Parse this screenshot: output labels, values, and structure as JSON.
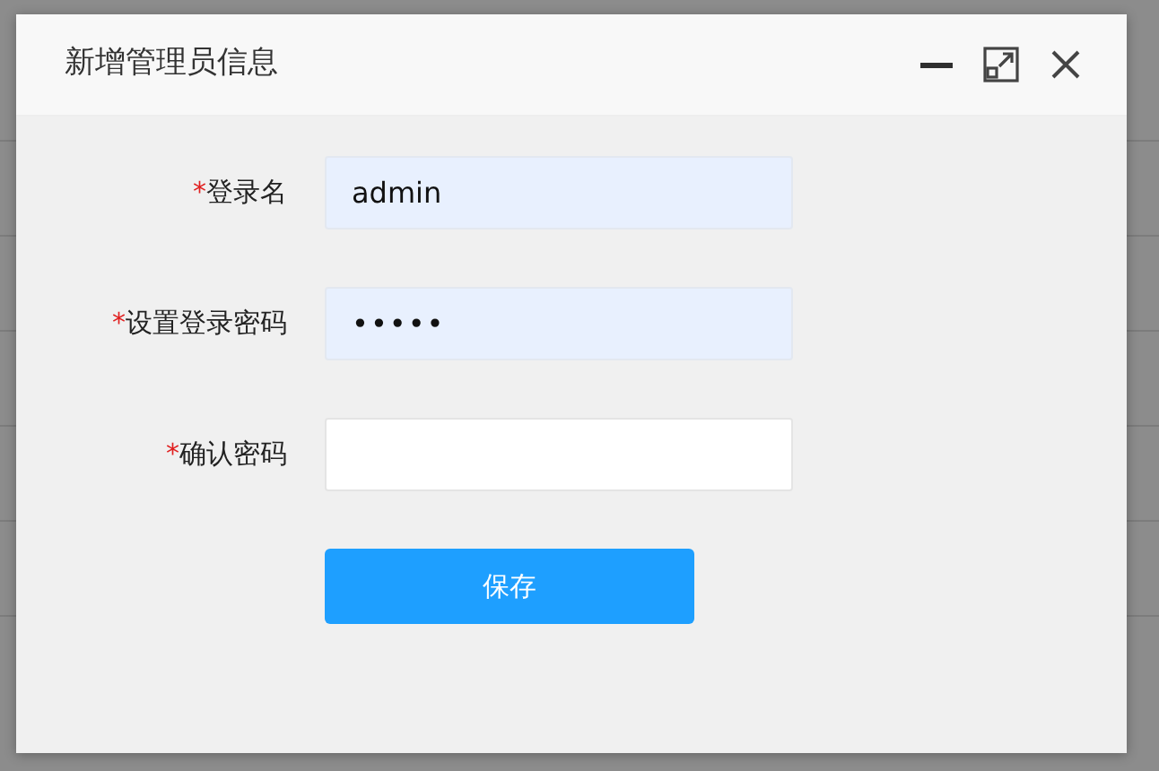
{
  "dialog": {
    "title": "新增管理员信息",
    "fields": [
      {
        "required_mark": "*",
        "label": "登录名",
        "kind": "text",
        "value": "admin",
        "autofilled": true
      },
      {
        "required_mark": "*",
        "label": "设置登录密码",
        "kind": "password",
        "value": "•••••",
        "autofilled": true
      },
      {
        "required_mark": "*",
        "label": "确认密码",
        "kind": "password",
        "autofilled": false
      }
    ],
    "save_button": "保存"
  }
}
